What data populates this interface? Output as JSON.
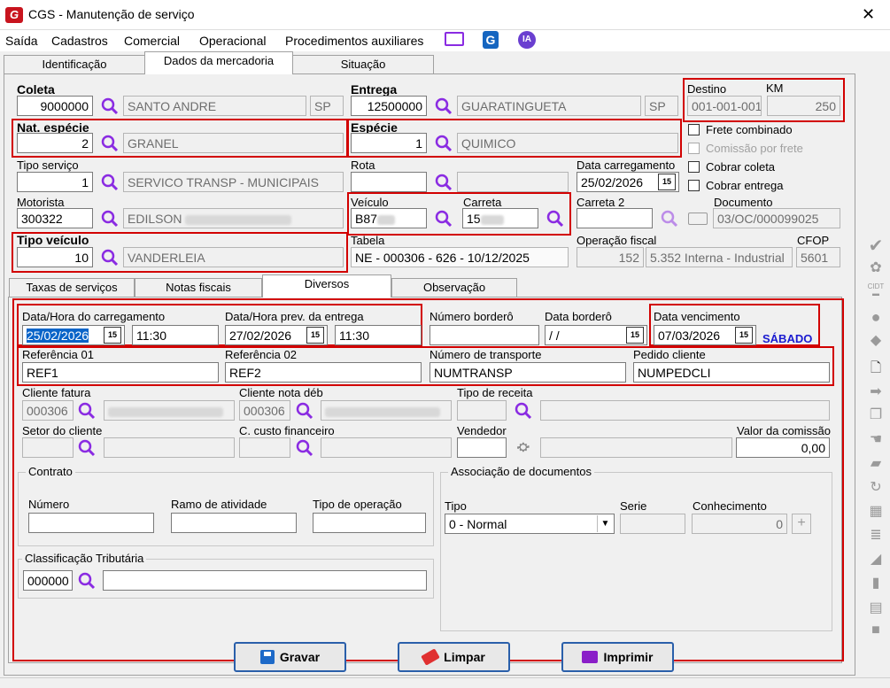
{
  "window": {
    "title": "CGS - Manutenção de serviço",
    "close": "✕"
  },
  "menu": [
    "Saída",
    "Cadastros",
    "Comercial",
    "Operacional",
    "Procedimentos auxiliares"
  ],
  "menu_icons": {
    "ia": "IA"
  },
  "tabs_top": [
    "Identificação",
    "Dados da mercadoria",
    "Situação"
  ],
  "coleta": {
    "label": "Coleta",
    "code": "9000000",
    "city": "SANTO ANDRE",
    "uf": "SP"
  },
  "entrega": {
    "label": "Entrega",
    "code": "12500000",
    "city": "GUARATINGUETA",
    "uf": "SP"
  },
  "destino": {
    "label": "Destino",
    "value": "001-001-001"
  },
  "km": {
    "label": "KM",
    "value": "250"
  },
  "nat_especie": {
    "label": "Nat. espécie",
    "code": "2",
    "name": "GRANEL"
  },
  "especie": {
    "label": "Espécie",
    "code": "1",
    "name": "QUIMICO"
  },
  "checks": {
    "frete_combinado": "Frete combinado",
    "comissao_frete": "Comissão por frete",
    "cobrar_coleta": "Cobrar coleta",
    "cobrar_entrega": "Cobrar entrega"
  },
  "tipo_servico": {
    "label": "Tipo serviço",
    "code": "1",
    "name": "SERVICO TRANSP - MUNICIPAIS"
  },
  "rota": {
    "label": "Rota"
  },
  "data_carregamento": {
    "label": "Data carregamento",
    "value": "25/02/2026"
  },
  "motorista": {
    "label": "Motorista",
    "code": "300322",
    "name": "EDILSON"
  },
  "veiculo": {
    "label": "Veículo",
    "value": "B87"
  },
  "carreta": {
    "label": "Carreta",
    "value": "15"
  },
  "carreta2": {
    "label": "Carreta 2"
  },
  "documento": {
    "label": "Documento",
    "value": "03/OC/000099025"
  },
  "tipo_veiculo": {
    "label": "Tipo veículo",
    "code": "10",
    "name": "VANDERLEIA"
  },
  "tabela": {
    "label": "Tabela",
    "value": "NE - 000306 - 626 - 10/12/2025"
  },
  "operacao_fiscal": {
    "label": "Operação fiscal",
    "code": "152",
    "name": "5.352  Interna - Industrial"
  },
  "cfop": {
    "label": "CFOP",
    "value": "5601"
  },
  "tabs_bottom": [
    "Taxas de serviços",
    "Notas fiscais",
    "Diversos",
    "Observação"
  ],
  "dh_carregamento": {
    "label": "Data/Hora do carregamento",
    "date": "25/02/2026",
    "time": "11:30"
  },
  "dh_entrega": {
    "label": "Data/Hora prev. da entrega",
    "date": "27/02/2026",
    "time": "11:30"
  },
  "numero_bordero": {
    "label": "Número borderô"
  },
  "data_bordero": {
    "label": "Data borderô",
    "value": " / /"
  },
  "data_vencimento": {
    "label": "Data vencimento",
    "value": "07/03/2026",
    "weekday": "SÁBADO"
  },
  "ref01": {
    "label": "Referência 01",
    "value": "REF1"
  },
  "ref02": {
    "label": "Referência 02",
    "value": "REF2"
  },
  "num_transporte": {
    "label": "Número de transporte",
    "value": "NUMTRANSP"
  },
  "pedido_cliente": {
    "label": "Pedido cliente",
    "value": "NUMPEDCLI"
  },
  "cliente_fatura": {
    "label": "Cliente fatura",
    "code": "000306"
  },
  "cliente_nota_deb": {
    "label": "Cliente nota déb",
    "code": "000306"
  },
  "tipo_receita": {
    "label": "Tipo de receita"
  },
  "setor_cliente": {
    "label": "Setor do cliente"
  },
  "c_custo": {
    "label": "C. custo financeiro"
  },
  "vendedor": {
    "label": "Vendedor"
  },
  "valor_comissao": {
    "label": "Valor da comissão",
    "value": "0,00"
  },
  "contrato": {
    "label": "Contrato",
    "numero": "Número",
    "ramo": "Ramo de atividade",
    "tipo_op": "Tipo de operação"
  },
  "assoc": {
    "label": "Associação de documentos",
    "tipo": "Tipo",
    "tipo_value": "0 - Normal",
    "serie": "Serie",
    "conhecimento": "Conhecimento",
    "conhecimento_value": "0"
  },
  "class_trib": {
    "label": "Classificação Tributária",
    "code": "000000"
  },
  "buttons": {
    "gravar": "Gravar",
    "limpar": "Limpar",
    "imprimir": "Imprimir"
  },
  "colors": {
    "highlight": "#d20000",
    "accent": "#2a5faa",
    "magnifier": "#8a2be2",
    "weekday": "#1a1ad0"
  }
}
